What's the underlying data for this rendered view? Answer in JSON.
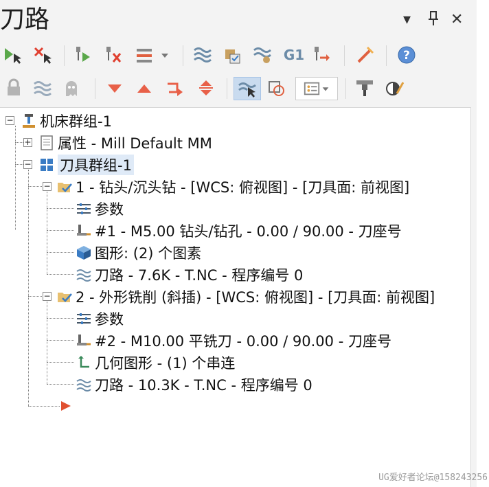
{
  "panel": {
    "title": "刀路",
    "controls": {
      "dropdown": "▾",
      "pin": "📌",
      "close": "✕"
    }
  },
  "toolbar": {
    "row1": [
      "select-all-ops",
      "deselect-all-ops",
      "regenerate-selected",
      "regenerate-dirty",
      "toggle-display",
      "backplot",
      "verify",
      "simulate",
      "g1-post",
      "post-selected",
      "highlight",
      "help"
    ],
    "row2": [
      "lock",
      "toggle-toolpath",
      "ghost",
      "move-down",
      "move-up",
      "insert-arrow",
      "expand-collapse",
      "view-selected",
      "select-mode",
      "filter"
    ],
    "g1_label": "G1"
  },
  "tree": {
    "root": {
      "label": "机床群组-1"
    },
    "properties": {
      "label": "属性 - Mill Default MM"
    },
    "tool_group": {
      "label": "刀具群组-1"
    },
    "op1": {
      "label": "1 - 钻头/沉头钻 - [WCS: 俯视图] - [刀具面: 前视图]",
      "params": "参数",
      "tool": "#1 - M5.00 钻头/钻孔 -  0.00 / 90.00 - 刀座号",
      "geometry": "图形: (2) 个图素",
      "toolpath": "刀路 - 7.6K - T.NC - 程序编号 0"
    },
    "op2": {
      "label": "2 - 外形铣削 (斜插) - [WCS: 俯视图] - [刀具面: 前视图]",
      "params": "参数",
      "tool": "#2 - M10.00 平铣刀 -  0.00 / 90.00 - 刀座号",
      "geometry": "几何图形 - (1) 个串连",
      "toolpath": "刀路 - 10.3K - T.NC - 程序编号 0"
    }
  },
  "watermark": "UG爱好者论坛@158243256",
  "colors": {
    "accent": "#dfeaf7",
    "insert_arrow": "#e05030",
    "tool_blue": "#3a7cc4"
  }
}
